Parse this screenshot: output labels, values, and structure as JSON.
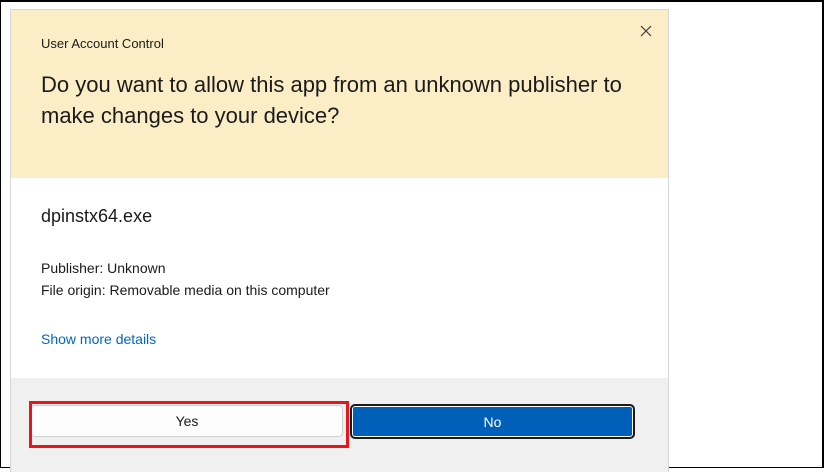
{
  "dialog": {
    "title": "User Account Control",
    "headline": "Do you want to allow this app from an unknown publisher to make changes to your device?",
    "app_name": "dpinstx64.exe",
    "publisher": "Publisher: Unknown",
    "file_origin": "File origin: Removable media on this computer",
    "details_link": "Show more details",
    "yes_label": "Yes",
    "no_label": "No",
    "close_icon": "close-icon"
  },
  "colors": {
    "header_bg": "#fbedc6",
    "link": "#0067c0",
    "primary_button": "#005fb8",
    "highlight": "#e8151b",
    "footer_bg": "#f0f0f0"
  }
}
